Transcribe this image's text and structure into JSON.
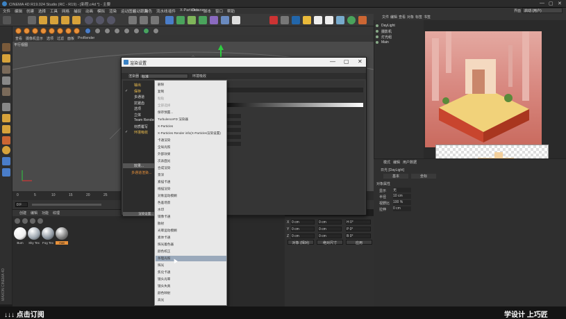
{
  "window": {
    "title": "CINEMA 4D R19.024 Studio (RC - R19) - [新程.c4d *] - 主要",
    "controls": [
      "—",
      "▢",
      "✕"
    ]
  },
  "menubar": [
    "文件",
    "编辑",
    "创建",
    "选择",
    "工具",
    "网格",
    "捕捉",
    "动画",
    "模拟",
    "渲染",
    "运动图形",
    "运动跟踪",
    "角色",
    "流水线",
    "插件",
    "X-Particles",
    "Octane",
    "脚本",
    "窗口",
    "帮助"
  ],
  "layout_label": "界面",
  "layout_value": "启动 (用户)",
  "viewport": {
    "menu": [
      "查看",
      "摄像机",
      "显示",
      "选项",
      "过滤",
      "面板",
      "ProRender"
    ],
    "label": "平行视图"
  },
  "timeline": {
    "ticks": [
      "0",
      "5",
      "10",
      "15",
      "20",
      "25"
    ],
    "frame": "0 F"
  },
  "material": {
    "menu": [
      "创建",
      "编辑",
      "功能",
      "纹理"
    ],
    "items": [
      {
        "label": "Bum",
        "color": "#eeeeee"
      },
      {
        "label": "Sky Tex",
        "color": "#9aa3ad"
      },
      {
        "label": "Fog Tex",
        "color": "#8a939d"
      },
      {
        "label": "mat",
        "color": "#7a7a7a"
      }
    ]
  },
  "coords": {
    "rows": [
      {
        "axis": "X",
        "pos": "0 cm",
        "size": "0 cm",
        "rot": "H 0°"
      },
      {
        "axis": "Y",
        "pos": "0 cm",
        "size": "0 cm",
        "rot": "P 0°"
      },
      {
        "axis": "Z",
        "pos": "0 cm",
        "size": "0 cm",
        "rot": "B 0°"
      }
    ],
    "buttons": [
      "对象 (相对)",
      "绝对尺寸",
      "应用"
    ]
  },
  "objects": {
    "menu": [
      "文件",
      "编辑",
      "查看",
      "对象",
      "标签",
      "书签"
    ],
    "items": [
      "DayLight",
      "摄影机",
      "灯光组",
      "Main"
    ]
  },
  "attributes": {
    "menu": [
      "模式",
      "编辑",
      "用户数据"
    ],
    "tabs": [
      "基本",
      "坐标"
    ],
    "header": "日光 [DayLight]",
    "section": "对象属性",
    "rows": [
      {
        "label": "显示",
        "value": "无"
      },
      {
        "label": "半径",
        "value": "10 cm"
      },
      {
        "label": "视野比",
        "value": "100 %"
      },
      {
        "label": "拉伸",
        "value": "0 cm"
      }
    ]
  },
  "dialog": {
    "title": "渲染设置",
    "renderer_label": "渲染器",
    "renderer_value": "标准",
    "right_header": "环境吸收",
    "left_items": [
      {
        "label": "输出",
        "checked": ""
      },
      {
        "label": "保存",
        "checked": "✓"
      },
      {
        "label": "多通道",
        "checked": ""
      },
      {
        "label": "抗锯齿",
        "checked": ""
      },
      {
        "label": "选项",
        "checked": ""
      },
      {
        "label": "立体",
        "checked": ""
      },
      {
        "label": "Team Render",
        "checked": ""
      },
      {
        "label": "材质覆写",
        "checked": ""
      },
      {
        "label": "环境吸收",
        "checked": "✓"
      }
    ],
    "effect_button": "效果...",
    "multi_button": "多通道渲染...",
    "my_setting": "我的渲染设置",
    "render_button": "渲染设置..."
  },
  "effects_menu": {
    "items": [
      {
        "label": "删除",
        "disabled": false
      },
      {
        "label": "复制",
        "disabled": false
      },
      {
        "label": "粘贴",
        "disabled": true
      },
      {
        "label": "全部选择",
        "disabled": true
      },
      {
        "label": "保存预置...",
        "disabled": false
      },
      {
        "label": "TurbulenceFD 渲染器",
        "disabled": false
      },
      {
        "label": "X-Particles",
        "disabled": false
      },
      {
        "label": "X-Particles Render info(X-Particles渲染设置)",
        "disabled": false
      },
      {
        "label": "卡通渲染",
        "disabled": false
      },
      {
        "label": "全局光照",
        "disabled": false
      },
      {
        "label": "外部效果",
        "disabled": false
      },
      {
        "label": "次表面光",
        "disabled": false
      },
      {
        "label": "合成渲染",
        "disabled": false
      },
      {
        "label": "景深",
        "disabled": false
      },
      {
        "label": "素描卡通",
        "disabled": false
      },
      {
        "label": "线描渲染",
        "disabled": false
      },
      {
        "label": "对象运动模糊",
        "disabled": false
      },
      {
        "label": "色差场景",
        "disabled": false
      },
      {
        "label": "水印",
        "disabled": false
      },
      {
        "label": "镜像卡通",
        "disabled": false
      },
      {
        "label": "散射",
        "disabled": false
      },
      {
        "label": "光晕运动模糊",
        "disabled": false
      },
      {
        "label": "素体卡通",
        "disabled": false
      },
      {
        "label": "辉光着色器",
        "disabled": false
      },
      {
        "label": "颜色校正",
        "disabled": false
      },
      {
        "label": "条理光照",
        "disabled": false
      },
      {
        "label": "辉光",
        "disabled": false
      },
      {
        "label": "焦化卡通",
        "disabled": false
      },
      {
        "label": "镜头光晕",
        "disabled": false
      },
      {
        "label": "镜头失真",
        "disabled": false
      },
      {
        "label": "颜色映射",
        "disabled": false
      },
      {
        "label": "高光",
        "disabled": false
      }
    ],
    "selected_index": 25
  },
  "brand": "MAXON CINEMA 4D",
  "bottom": {
    "left": "↓↓↓ 点击订阅",
    "right": "学设计 上巧匠"
  },
  "colors": {
    "accent_orange": "#e8913a",
    "highlight": "#9aa9bb",
    "panel": "#3a3a3a"
  }
}
